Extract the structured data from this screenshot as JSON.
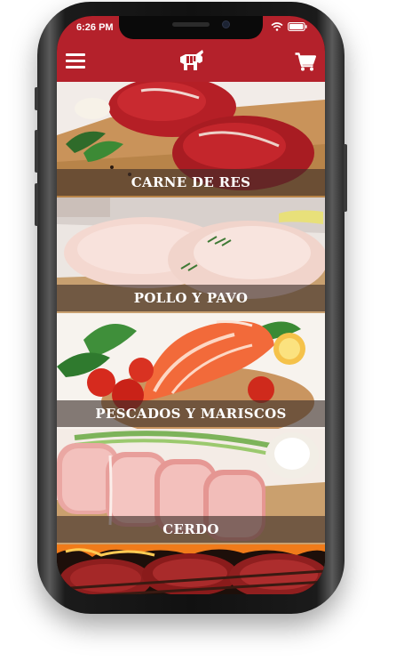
{
  "status_bar": {
    "time": "6:26 PM"
  },
  "header": {
    "menu_icon": "hamburger-menu-icon",
    "logo_icon": "bull-logo-icon",
    "cart_icon": "shopping-cart-icon"
  },
  "categories": [
    {
      "label": "CARNE DE RES"
    },
    {
      "label": "POLLO Y PAVO"
    },
    {
      "label": "PESCADOS Y MARISCOS"
    },
    {
      "label": "CERDO"
    },
    {
      "label": ""
    }
  ],
  "colors": {
    "brand_red": "#b4212b",
    "label_overlay": "#3c2d28"
  }
}
